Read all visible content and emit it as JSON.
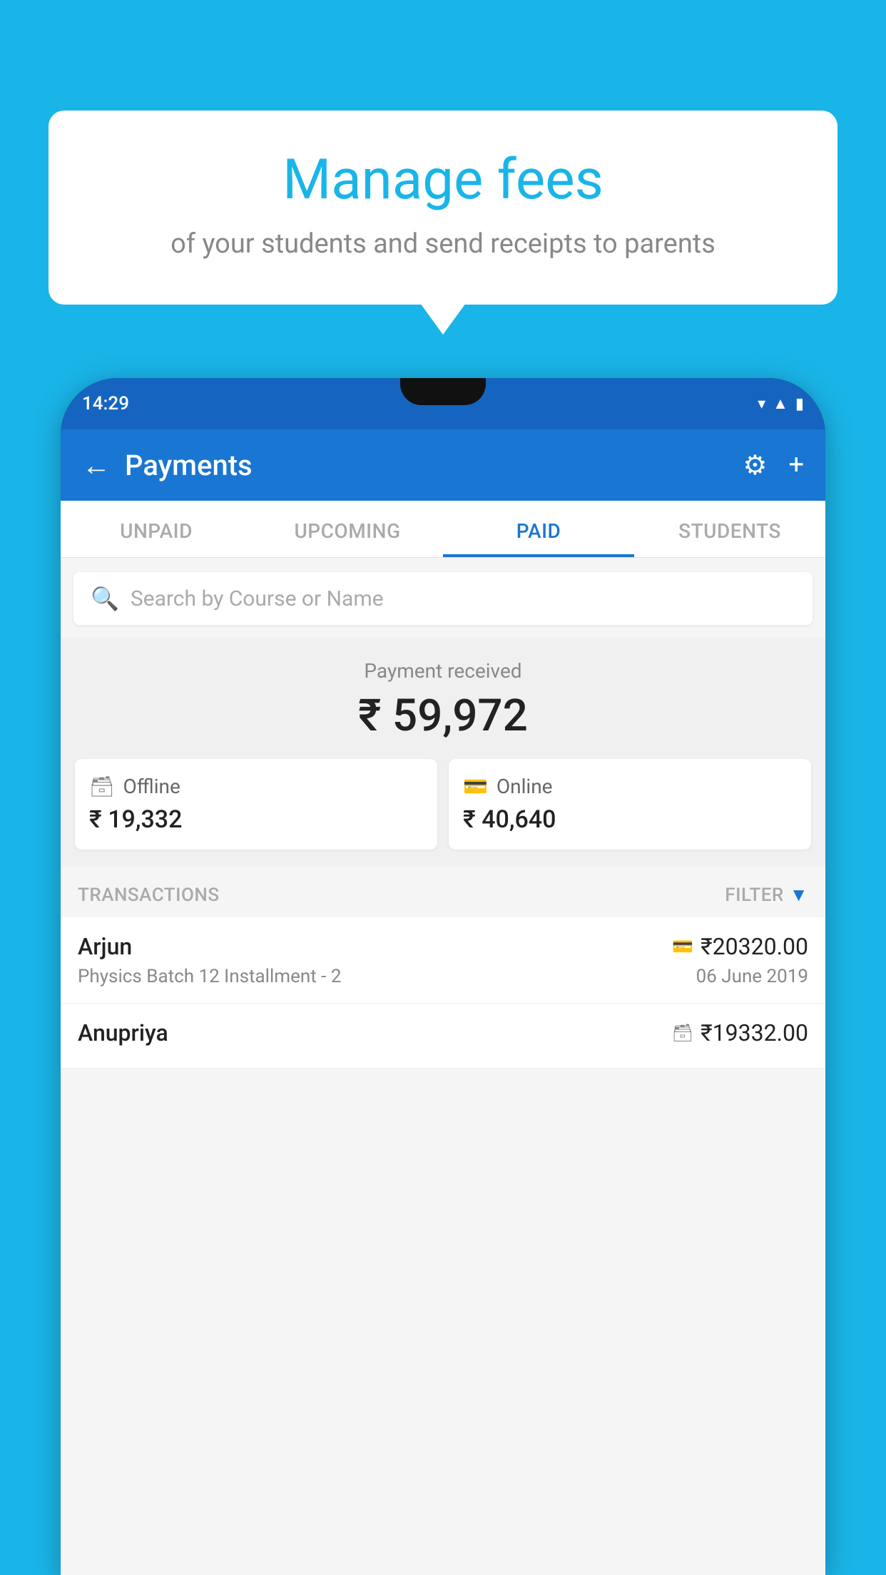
{
  "background_color": "#1ab5e8",
  "bubble": {
    "title": "Manage fees",
    "subtitle": "of your students and send receipts to parents"
  },
  "status_bar": {
    "time": "14:29",
    "icons": [
      "wifi",
      "signal",
      "battery"
    ]
  },
  "app_bar": {
    "title": "Payments",
    "back_icon": "←",
    "settings_icon": "⚙",
    "add_icon": "+"
  },
  "tabs": [
    {
      "label": "UNPAID",
      "active": false
    },
    {
      "label": "UPCOMING",
      "active": false
    },
    {
      "label": "PAID",
      "active": true
    },
    {
      "label": "STUDENTS",
      "active": false
    }
  ],
  "search": {
    "placeholder": "Search by Course or Name"
  },
  "payment_summary": {
    "label": "Payment received",
    "total": "₹ 59,972",
    "offline": {
      "label": "Offline",
      "amount": "₹ 19,332"
    },
    "online": {
      "label": "Online",
      "amount": "₹ 40,640"
    }
  },
  "transactions": {
    "label": "TRANSACTIONS",
    "filter_label": "FILTER",
    "items": [
      {
        "name": "Arjun",
        "course": "Physics Batch 12 Installment - 2",
        "amount": "₹20320.00",
        "date": "06 June 2019",
        "payment_type": "card"
      },
      {
        "name": "Anupriya",
        "course": "",
        "amount": "₹19332.00",
        "date": "",
        "payment_type": "cash"
      }
    ]
  }
}
